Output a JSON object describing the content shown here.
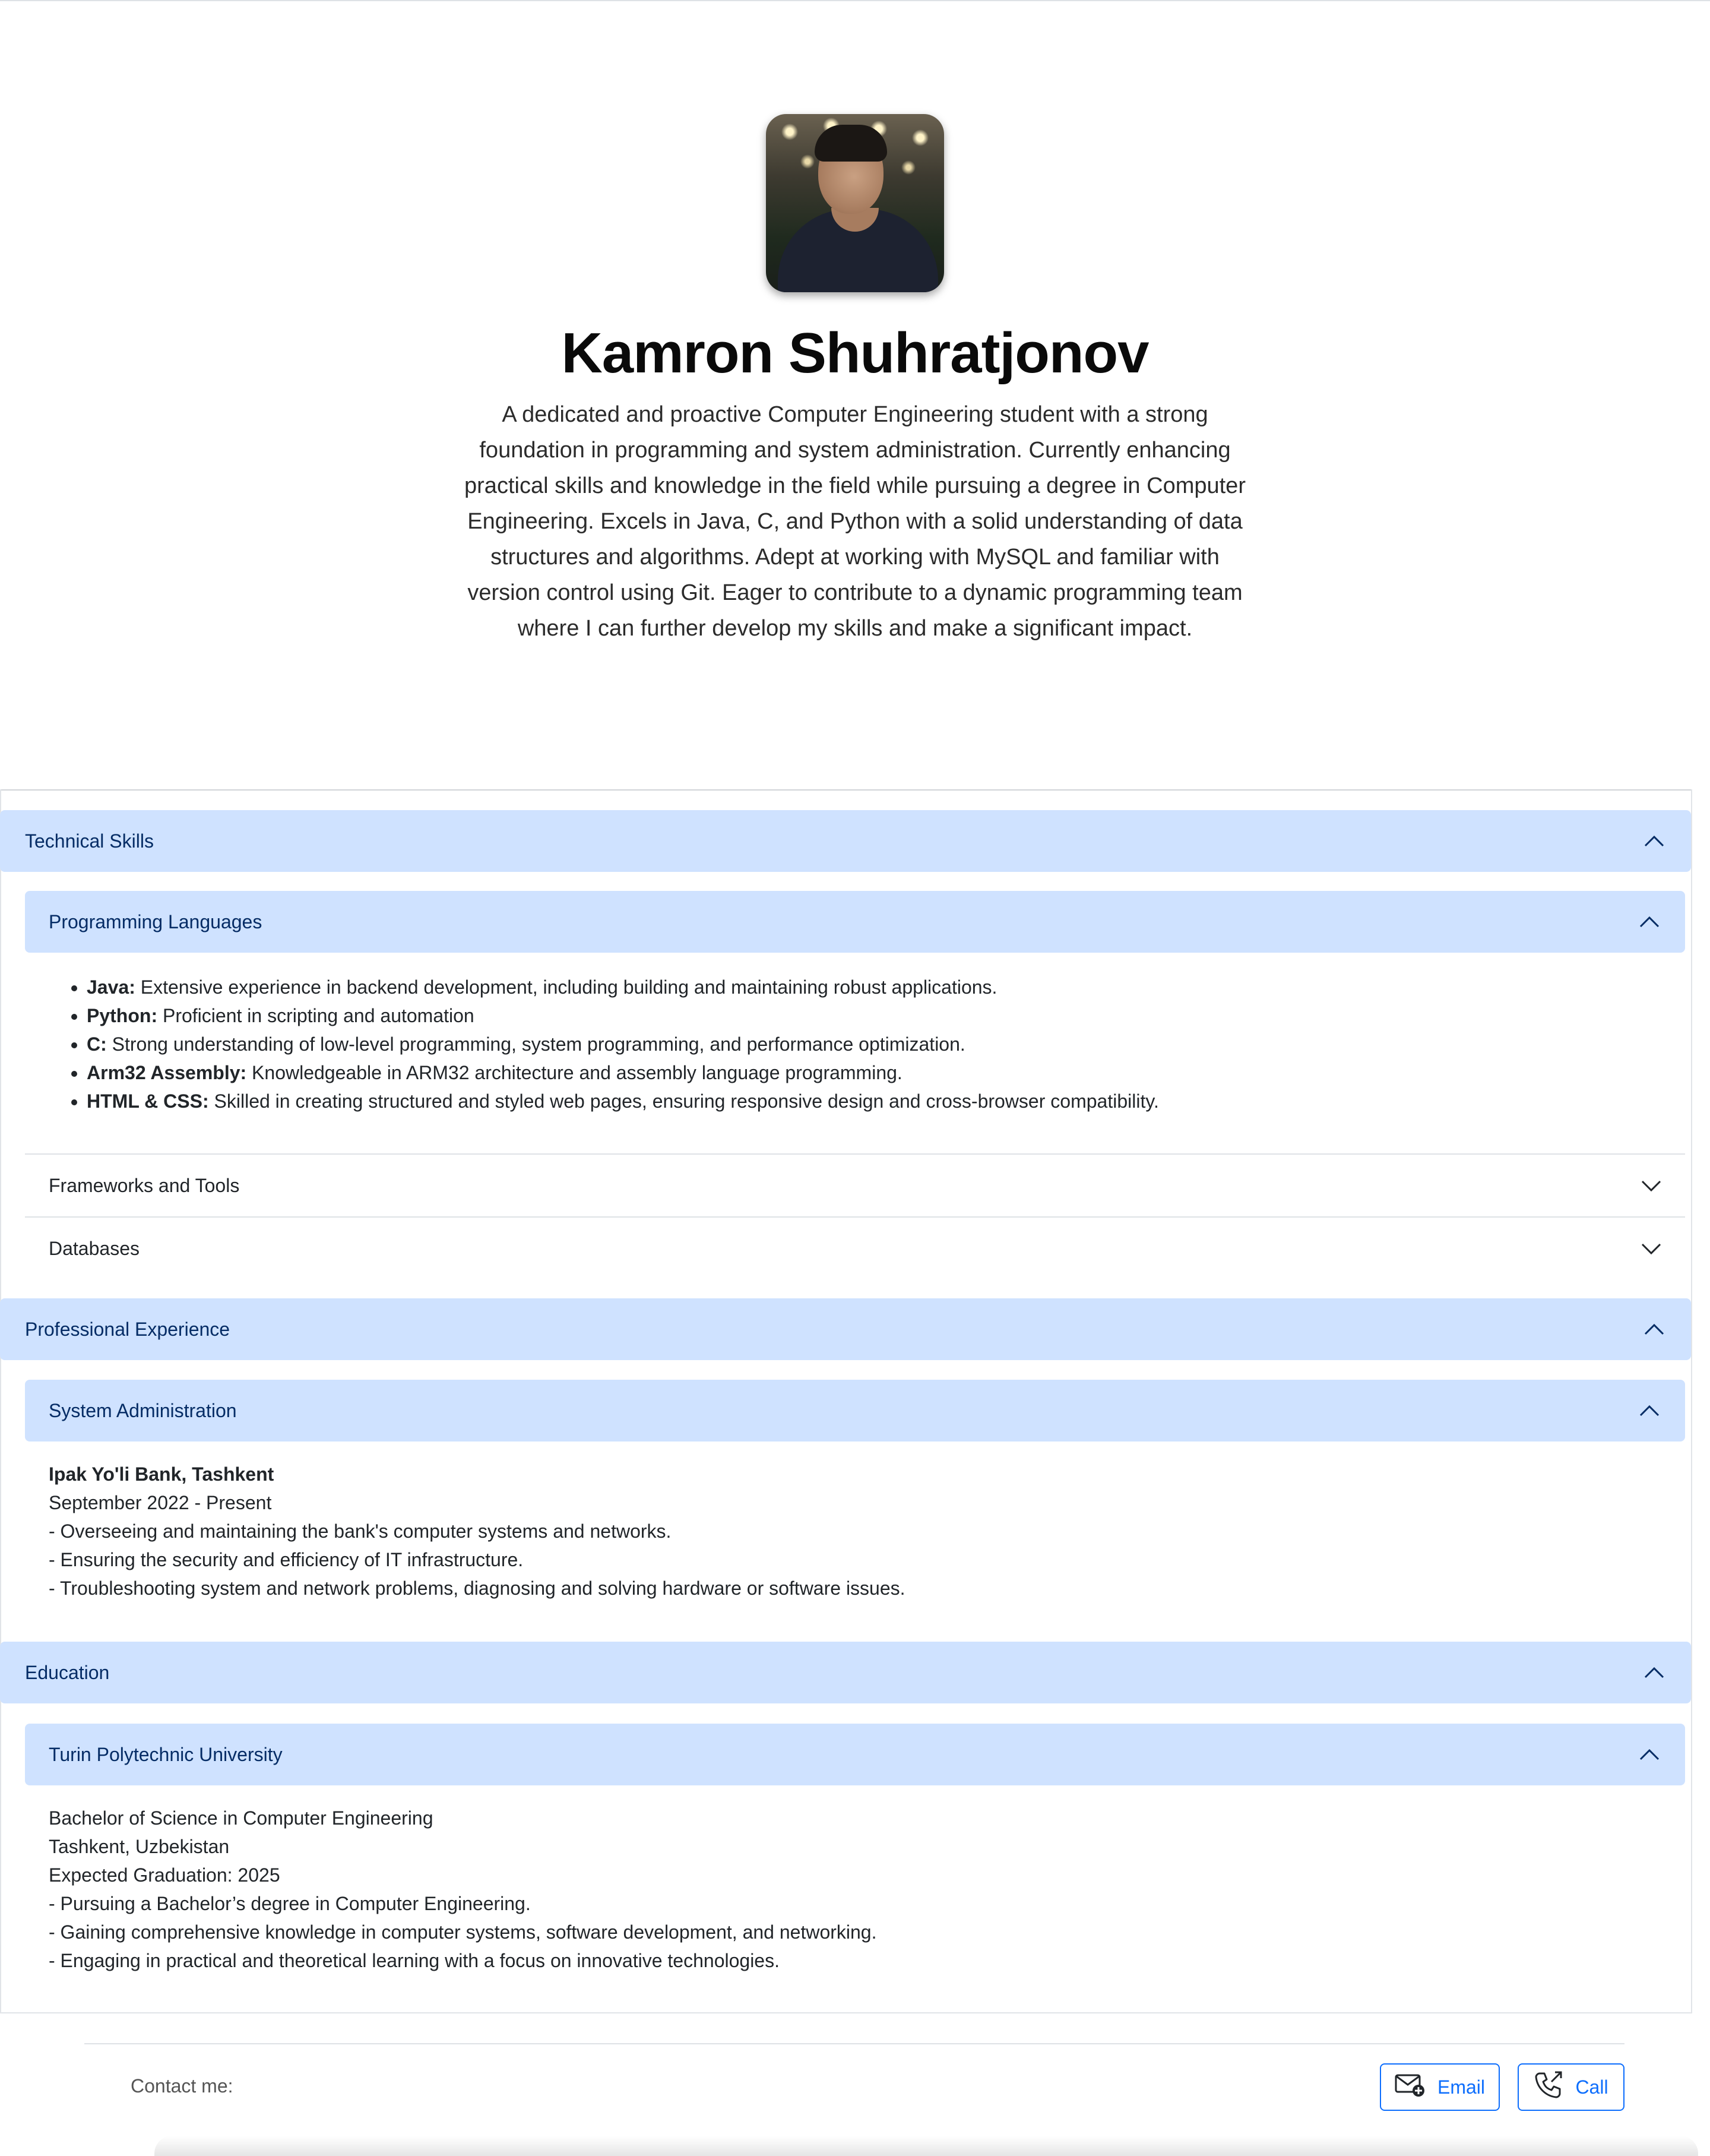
{
  "profile": {
    "name": "Kamron Shuhratjonov",
    "bio": "A dedicated and proactive Computer Engineering student with a strong foundation in programming and system administration. Currently enhancing practical skills and knowledge in the field while pursuing a degree in Computer Engineering. Excels in Java, C, and Python with a solid understanding of data structures and algorithms. Adept at working with MySQL and familiar with version control using Git. Eager to contribute to a dynamic programming team where I can further develop my skills and make a significant impact."
  },
  "sections": {
    "technical_skills": {
      "title": "Technical Skills",
      "programming_languages": {
        "title": "Programming Languages",
        "items": [
          {
            "label": "Java:",
            "text": " Extensive experience in backend development, including building and maintaining robust applications."
          },
          {
            "label": "Python:",
            "text": " Proficient in scripting and automation"
          },
          {
            "label": "C:",
            "text": " Strong understanding of low-level programming, system programming, and performance optimization."
          },
          {
            "label": "Arm32 Assembly:",
            "text": " Knowledgeable in ARM32 architecture and assembly language programming."
          },
          {
            "label": "HTML & CSS:",
            "text": " Skilled in creating structured and styled web pages, ensuring responsive design and cross-browser compatibility."
          }
        ]
      },
      "frameworks": {
        "title": "Frameworks and Tools"
      },
      "databases": {
        "title": "Databases"
      }
    },
    "experience": {
      "title": "Professional Experience",
      "sysadmin": {
        "title": "System Administration",
        "company": "Ipak Yo'li Bank, Tashkent",
        "period": "September 2022 - Present",
        "duties": [
          "- Overseeing and maintaining the bank's computer systems and networks.",
          "- Ensuring the security and efficiency of IT infrastructure.",
          "- Troubleshooting system and network problems, diagnosing and solving hardware or software issues."
        ]
      }
    },
    "education": {
      "title": "Education",
      "university": {
        "title": "Turin Polytechnic University",
        "lines": [
          "Bachelor of Science in Computer Engineering",
          "Tashkent, Uzbekistan",
          "Expected Graduation: 2025",
          "- Pursuing a Bachelor’s degree in Computer Engineering.",
          "- Gaining comprehensive knowledge in computer systems, software development, and networking.",
          "- Engaging in practical and theoretical learning with a focus on innovative technologies."
        ]
      }
    }
  },
  "footer": {
    "contact_label": "Contact me:",
    "email_label": "Email",
    "call_label": "Call"
  },
  "colors": {
    "accordion_bg": "#cfe2ff",
    "accordion_text": "#052c65",
    "button_blue": "#0d6efd"
  },
  "icons": {
    "expanded": "chevron-up-icon",
    "collapsed": "chevron-down-icon",
    "email": "envelope-plus-icon",
    "call": "phone-outgoing-icon"
  }
}
